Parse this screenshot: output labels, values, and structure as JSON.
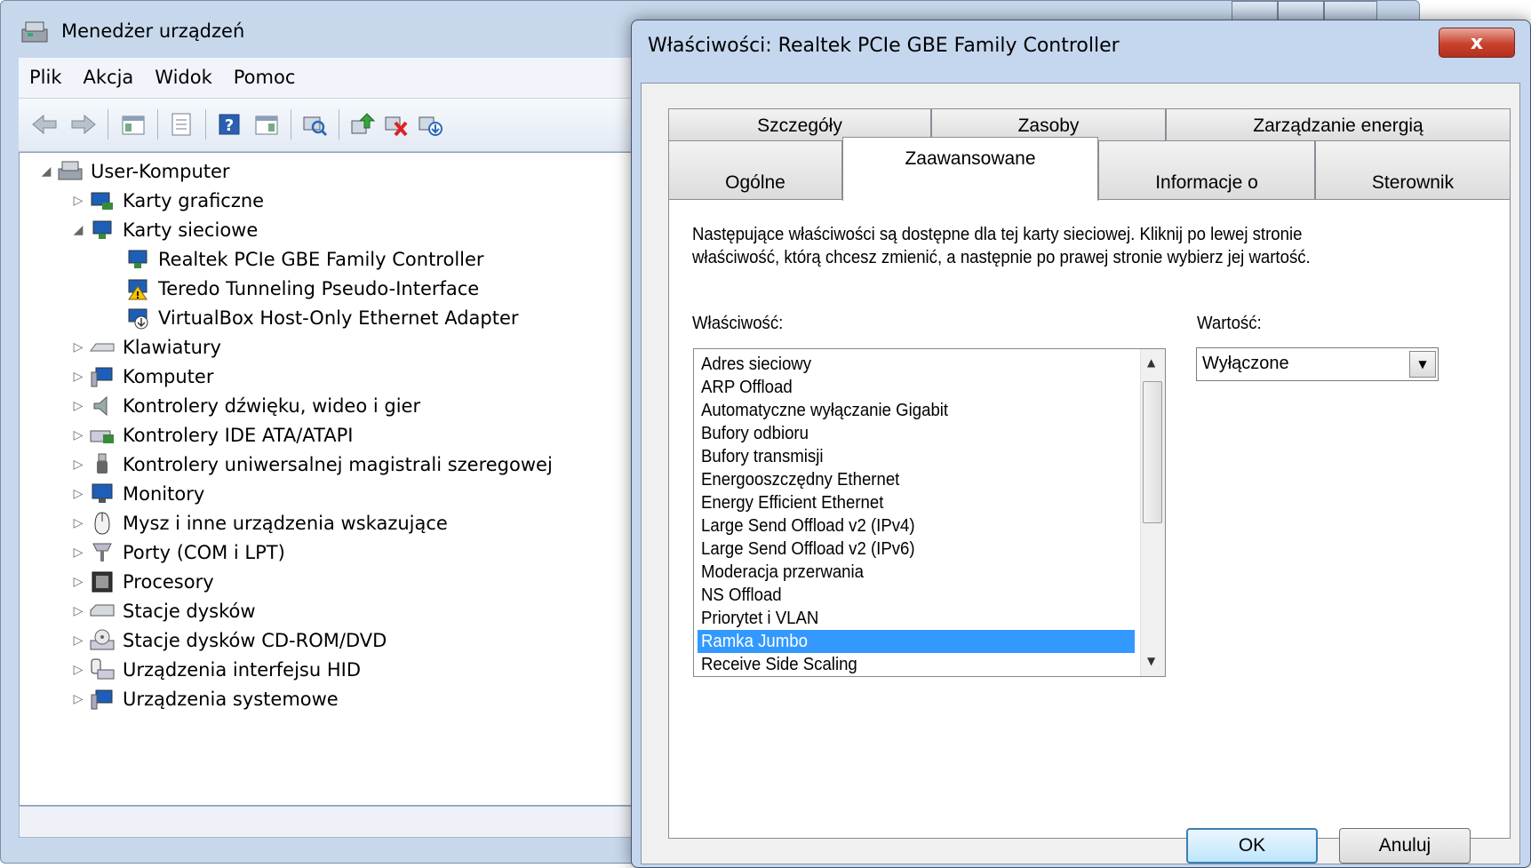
{
  "device_manager": {
    "title": "Menedżer urządzeń",
    "menu": [
      "Plik",
      "Akcja",
      "Widok",
      "Pomoc"
    ],
    "toolbar_icons": [
      "back-arrow-icon",
      "forward-arrow-icon",
      "show-hide-tree-icon",
      "properties-icon",
      "help-icon",
      "action-pane-icon",
      "scan-hardware-icon",
      "update-driver-icon",
      "disable-device-icon",
      "uninstall-device-icon"
    ],
    "tree": {
      "root": "User-Komputer",
      "categories": [
        {
          "label": "Karty graficzne",
          "icon": "display-adapter-icon",
          "expanded": false
        },
        {
          "label": "Karty sieciowe",
          "icon": "network-adapter-icon",
          "expanded": true,
          "children": [
            {
              "label": "Realtek PCIe GBE Family Controller",
              "icon": "network-adapter-icon"
            },
            {
              "label": "Teredo Tunneling Pseudo-Interface",
              "icon": "network-adapter-warning-icon"
            },
            {
              "label": "VirtualBox Host-Only Ethernet Adapter",
              "icon": "network-adapter-download-icon"
            }
          ]
        },
        {
          "label": "Klawiatury",
          "icon": "keyboard-icon",
          "expanded": false
        },
        {
          "label": "Komputer",
          "icon": "computer-icon",
          "expanded": false
        },
        {
          "label": "Kontrolery dźwięku, wideo i gier",
          "icon": "speaker-icon",
          "expanded": false
        },
        {
          "label": "Kontrolery IDE ATA/ATAPI",
          "icon": "ide-controller-icon",
          "expanded": false
        },
        {
          "label": "Kontrolery uniwersalnej magistrali szeregowej",
          "icon": "usb-icon",
          "expanded": false
        },
        {
          "label": "Monitory",
          "icon": "monitor-icon",
          "expanded": false
        },
        {
          "label": "Mysz i inne urządzenia wskazujące",
          "icon": "mouse-icon",
          "expanded": false
        },
        {
          "label": "Porty (COM i LPT)",
          "icon": "port-icon",
          "expanded": false
        },
        {
          "label": "Procesory",
          "icon": "processor-icon",
          "expanded": false
        },
        {
          "label": "Stacje dysków",
          "icon": "disk-drive-icon",
          "expanded": false
        },
        {
          "label": "Stacje dysków CD-ROM/DVD",
          "icon": "cdrom-icon",
          "expanded": false
        },
        {
          "label": "Urządzenia interfejsu HID",
          "icon": "hid-icon",
          "expanded": false
        },
        {
          "label": "Urządzenia systemowe",
          "icon": "system-devices-icon",
          "expanded": false
        }
      ]
    }
  },
  "dialog": {
    "title": "Właściwości: Realtek PCIe GBE Family Controller",
    "close_label": "x",
    "tabs_row_back": [
      "Szczegóły",
      "Zasoby",
      "Zarządzanie energią"
    ],
    "tabs_row_front": [
      "Ogólne",
      "Zaawansowane",
      "Informacje o",
      "Sterownik"
    ],
    "active_tab": "Zaawansowane",
    "description_line1": "Następujące właściwości są dostępne dla tej karty sieciowej. Kliknij po lewej stronie",
    "description_line2": "właściwość, którą chcesz zmienić, a następnie po prawej stronie wybierz jej wartość.",
    "property_label": "Właściwość:",
    "value_label": "Wartość:",
    "properties": [
      "Adres sieciowy",
      "ARP Offload",
      "Automatyczne wyłączanie Gigabit",
      "Bufory odbioru",
      "Bufory transmisji",
      "Energooszczędny Ethernet",
      "Energy Efficient Ethernet",
      "Large Send Offload v2 (IPv4)",
      "Large Send Offload v2 (IPv6)",
      "Moderacja przerwania",
      "NS Offload",
      "Priorytet i VLAN",
      "Ramka Jumbo",
      "Receive Side Scaling"
    ],
    "selected_property": "Ramka Jumbo",
    "value": "Wyłączone",
    "ok_label": "OK",
    "cancel_label": "Anuluj",
    "selection_color": "#3399ff"
  }
}
